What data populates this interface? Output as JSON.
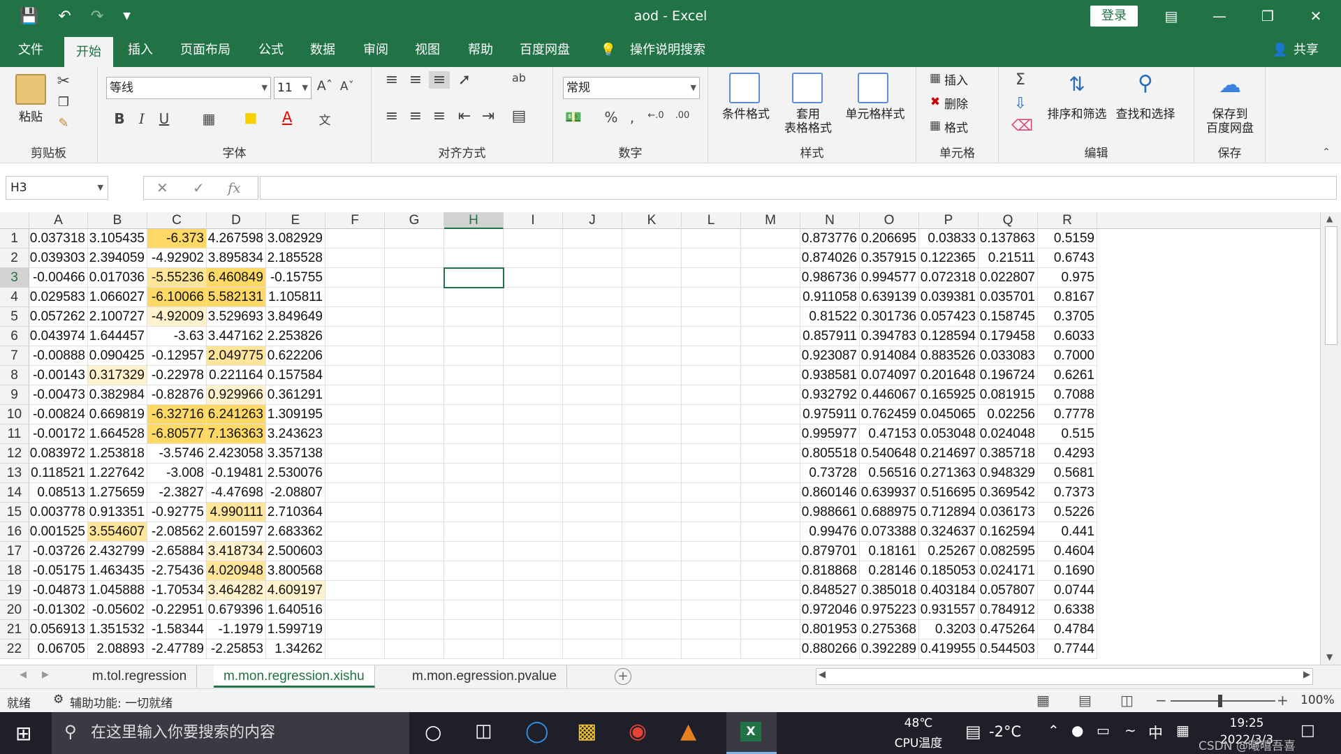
{
  "titlebar": {
    "title": "aod  -  Excel",
    "login": "登录",
    "qat_icons": [
      "save-icon",
      "undo-icon",
      "redo-icon",
      "customize-icon"
    ]
  },
  "menu": {
    "tabs": [
      "文件",
      "开始",
      "插入",
      "页面布局",
      "公式",
      "数据",
      "审阅",
      "视图",
      "帮助",
      "百度网盘"
    ],
    "tell_me": "操作说明搜索",
    "share": "共享",
    "active_tab": "开始"
  },
  "ribbon": {
    "clipboard": {
      "label": "剪贴板",
      "paste": "粘贴"
    },
    "font": {
      "label": "字体",
      "font_name": "等线",
      "font_size": "11"
    },
    "alignment": {
      "label": "对齐方式"
    },
    "number": {
      "label": "数字",
      "format": "常规"
    },
    "styles": {
      "label": "样式",
      "conditional": "条件格式",
      "table_line1": "套用",
      "table_line2": "表格格式",
      "cell_styles": "单元格样式"
    },
    "cells": {
      "label": "单元格",
      "insert": "插入",
      "delete": "删除",
      "format": "格式"
    },
    "editing": {
      "label": "编辑",
      "sort": "排序和筛选",
      "find": "查找和选择"
    },
    "save": {
      "label": "保存",
      "line1": "保存到",
      "line2": "百度网盘"
    }
  },
  "formula_bar": {
    "name_box": "H3",
    "formula": ""
  },
  "columns": [
    "A",
    "B",
    "C",
    "D",
    "E",
    "F",
    "G",
    "H",
    "I",
    "J",
    "K",
    "L",
    "M",
    "N",
    "O",
    "P",
    "Q",
    "R"
  ],
  "rows": [
    {
      "n": "1",
      "A": "0.037318",
      "B": "3.105435",
      "C": "-6.373",
      "D": "4.267598",
      "E": "3.082929",
      "N": "0.873776",
      "O": "0.206695",
      "P": "0.03833",
      "Q": "0.137863",
      "R": "0.5159"
    },
    {
      "n": "2",
      "A": "0.039303",
      "B": "2.394059",
      "C": "-4.92902",
      "D": "3.895834",
      "E": "2.185528",
      "N": "0.874026",
      "O": "0.357915",
      "P": "0.122365",
      "Q": "0.21511",
      "R": "0.6743"
    },
    {
      "n": "3",
      "A": "-0.00466",
      "B": "0.017036",
      "C": "-5.55236",
      "D": "6.460849",
      "E": "-0.15755",
      "N": "0.986736",
      "O": "0.994577",
      "P": "0.072318",
      "Q": "0.022807",
      "R": "0.975"
    },
    {
      "n": "4",
      "A": "0.029583",
      "B": "1.066027",
      "C": "-6.10066",
      "D": "5.582131",
      "E": "1.105811",
      "N": "0.911058",
      "O": "0.639139",
      "P": "0.039381",
      "Q": "0.035701",
      "R": "0.8167"
    },
    {
      "n": "5",
      "A": "0.057262",
      "B": "2.100727",
      "C": "-4.92009",
      "D": "3.529693",
      "E": "3.849649",
      "N": "0.81522",
      "O": "0.301736",
      "P": "0.057423",
      "Q": "0.158745",
      "R": "0.3705"
    },
    {
      "n": "6",
      "A": "0.043974",
      "B": "1.644457",
      "C": "-3.63",
      "D": "3.447162",
      "E": "2.253826",
      "N": "0.857911",
      "O": "0.394783",
      "P": "0.128594",
      "Q": "0.179458",
      "R": "0.6033"
    },
    {
      "n": "7",
      "A": "-0.00888",
      "B": "0.090425",
      "C": "-0.12957",
      "D": "2.049775",
      "E": "0.622206",
      "N": "0.923087",
      "O": "0.914084",
      "P": "0.883526",
      "Q": "0.033083",
      "R": "0.7000"
    },
    {
      "n": "8",
      "A": "-0.00143",
      "B": "0.317329",
      "C": "-0.22978",
      "D": "0.221164",
      "E": "0.157584",
      "N": "0.938581",
      "O": "0.074097",
      "P": "0.201648",
      "Q": "0.196724",
      "R": "0.6261"
    },
    {
      "n": "9",
      "A": "-0.00473",
      "B": "0.382984",
      "C": "-0.82876",
      "D": "0.929966",
      "E": "0.361291",
      "N": "0.932792",
      "O": "0.446067",
      "P": "0.165925",
      "Q": "0.081915",
      "R": "0.7088"
    },
    {
      "n": "10",
      "A": "-0.00824",
      "B": "0.669819",
      "C": "-6.32716",
      "D": "6.241263",
      "E": "1.309195",
      "N": "0.975911",
      "O": "0.762459",
      "P": "0.045065",
      "Q": "0.02256",
      "R": "0.7778"
    },
    {
      "n": "11",
      "A": "-0.00172",
      "B": "1.664528",
      "C": "-6.80577",
      "D": "7.136363",
      "E": "3.243623",
      "N": "0.995977",
      "O": "0.47153",
      "P": "0.053048",
      "Q": "0.024048",
      "R": "0.515"
    },
    {
      "n": "12",
      "A": "0.083972",
      "B": "1.253818",
      "C": "-3.5746",
      "D": "2.423058",
      "E": "3.357138",
      "N": "0.805518",
      "O": "0.540648",
      "P": "0.214697",
      "Q": "0.385718",
      "R": "0.4293"
    },
    {
      "n": "13",
      "A": "0.118521",
      "B": "1.227642",
      "C": "-3.008",
      "D": "-0.19481",
      "E": "2.530076",
      "N": "0.73728",
      "O": "0.56516",
      "P": "0.271363",
      "Q": "0.948329",
      "R": "0.5681"
    },
    {
      "n": "14",
      "A": "0.08513",
      "B": "1.275659",
      "C": "-2.3827",
      "D": "-4.47698",
      "E": "-2.08807",
      "N": "0.860146",
      "O": "0.639937",
      "P": "0.516695",
      "Q": "0.369542",
      "R": "0.7373"
    },
    {
      "n": "15",
      "A": "0.003778",
      "B": "0.913351",
      "C": "-0.92775",
      "D": "4.990111",
      "E": "2.710364",
      "N": "0.988661",
      "O": "0.688975",
      "P": "0.712894",
      "Q": "0.036173",
      "R": "0.5226"
    },
    {
      "n": "16",
      "A": "0.001525",
      "B": "3.554607",
      "C": "-2.08562",
      "D": "2.601597",
      "E": "2.683362",
      "N": "0.99476",
      "O": "0.073388",
      "P": "0.324637",
      "Q": "0.162594",
      "R": "0.441"
    },
    {
      "n": "17",
      "A": "-0.03726",
      "B": "2.432799",
      "C": "-2.65884",
      "D": "3.418734",
      "E": "2.500603",
      "N": "0.879701",
      "O": "0.18161",
      "P": "0.25267",
      "Q": "0.082595",
      "R": "0.4604"
    },
    {
      "n": "18",
      "A": "-0.05175",
      "B": "1.463435",
      "C": "-2.75436",
      "D": "4.020948",
      "E": "3.800568",
      "N": "0.818868",
      "O": "0.28146",
      "P": "0.185053",
      "Q": "0.024171",
      "R": "0.1690"
    },
    {
      "n": "19",
      "A": "-0.04873",
      "B": "1.045888",
      "C": "-1.70534",
      "D": "3.464282",
      "E": "4.609197",
      "N": "0.848527",
      "O": "0.385018",
      "P": "0.403184",
      "Q": "0.057807",
      "R": "0.0744"
    },
    {
      "n": "20",
      "A": "-0.01302",
      "B": "-0.05602",
      "C": "-0.22951",
      "D": "0.679396",
      "E": "1.640516",
      "N": "0.972046",
      "O": "0.975223",
      "P": "0.931557",
      "Q": "0.784912",
      "R": "0.6338"
    },
    {
      "n": "21",
      "A": "0.056913",
      "B": "1.351532",
      "C": "-1.58344",
      "D": "-1.1979",
      "E": "1.599719",
      "N": "0.801953",
      "O": "0.275368",
      "P": "0.3203",
      "Q": "0.475264",
      "R": "0.4784"
    },
    {
      "n": "22",
      "A": "0.06705",
      "B": "2.08893",
      "C": "-2.47789",
      "D": "-2.25853",
      "E": "1.34262",
      "N": "0.880266",
      "O": "0.392289",
      "P": "0.419955",
      "Q": "0.544503",
      "R": "0.7744"
    }
  ],
  "highlights": {
    "colors": {
      "strong": "#ffd966",
      "medium": "#ffe599",
      "light": "#fff2cc"
    },
    "cells": [
      [
        "C1",
        "strong"
      ],
      [
        "C3",
        "medium"
      ],
      [
        "C4",
        "strong"
      ],
      [
        "C5",
        "light"
      ],
      [
        "C10",
        "strong"
      ],
      [
        "C11",
        "strong"
      ],
      [
        "D3",
        "strong"
      ],
      [
        "D4",
        "strong"
      ],
      [
        "D7",
        "medium"
      ],
      [
        "D9",
        "light"
      ],
      [
        "D10",
        "strong"
      ],
      [
        "D11",
        "strong"
      ],
      [
        "D15",
        "medium"
      ],
      [
        "D17",
        "light"
      ],
      [
        "D18",
        "medium"
      ],
      [
        "D19",
        "light"
      ],
      [
        "B8",
        "light"
      ],
      [
        "B16",
        "medium"
      ],
      [
        "E19",
        "light"
      ]
    ]
  },
  "sheets": [
    "m.tol.regression",
    "m.mon.regression.xishu",
    "m.mon.egression.pvalue"
  ],
  "active_sheet": "m.mon.regression.xishu",
  "status": {
    "ready": "就绪",
    "accessibility": "辅助功能: 一切就绪",
    "zoom": "100%"
  },
  "taskbar": {
    "search_placeholder": "在这里输入你要搜索的内容",
    "cpu_temp": "48℃",
    "cpu_label": "CPU温度",
    "weather": "-2°C",
    "ime": "中",
    "time": "19:25",
    "date": "2022/3/3",
    "watermark": "CSDN @曦嘻吾喜"
  },
  "accent_color": "#217346"
}
